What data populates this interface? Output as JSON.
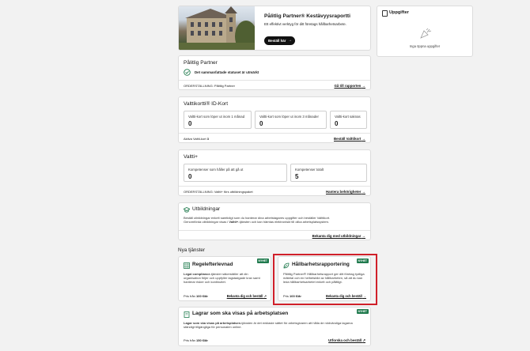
{
  "report_card": {
    "title": "Pålitlig Partner® Kestävyysraportti",
    "desc": "Ett effektivt verktyg för ditt företags hållbarhetsarbete.",
    "button": "Beställ här"
  },
  "tasks_card": {
    "title": "Uppgifter",
    "empty": "Inga öppna uppgifter"
  },
  "partner_card": {
    "title": "Pålitlig Partner",
    "status": "Det sammanfattade statuset är utmärkt",
    "subscription": "ORDERSTÄLLNING: Pålitlig Partner",
    "link": "Gå till rapporten"
  },
  "idcard_card": {
    "title": "Valttikortti® ID-Kort",
    "boxes": [
      {
        "label": "Valtti-kort som löper ut inom 1 månad",
        "value": "0"
      },
      {
        "label": "Valtti-kort som löper ut inom 3 månader",
        "value": "0"
      },
      {
        "label": "Valtti-kort saknas",
        "value": "0"
      }
    ],
    "active_label": "Aktiva Valtti-kort",
    "active_value": "3",
    "link": "Beställ Valttikort"
  },
  "valttiplus_card": {
    "title": "Valtti+",
    "boxes": [
      {
        "label": "Kompetenser som håller på att gå ut",
        "value": "0"
      },
      {
        "label": "Kompetenser totalt",
        "value": "5"
      }
    ],
    "subscription": "ORDERSTÄLLNING: Valtti+ förs utbildningspaket",
    "link": "Hantera behörigheter"
  },
  "training_card": {
    "title": "Utbildningar",
    "desc_1": "Beställ utbildningar enkelt samtidigt som du hanterar dina arbetstagares uppgifter och beställer Valttikort.",
    "desc_2a": "Genomförda utbildningar visas i ",
    "desc_2b": "Valtti+",
    "desc_2c": "-tjänsten och kan hämtas elektroniskt till olika arbetsplatssystem.",
    "link": "Bekanta dig med utbildningar"
  },
  "new_services": {
    "heading": "Nya tjänster",
    "services": [
      {
        "title": "Regelefterlevnad",
        "badge": "NYHET",
        "bold": "Legal compliance",
        "desc": "-tjänster säkerställer att din organisation följer och uppfyller lagstadgade krav samt hanterar risker och kontinuitet.",
        "price_label": "Pris från",
        "price": "100 €/år",
        "link": "Bekanta dig och beställ"
      },
      {
        "title": "Hållbarhetsrapportering",
        "badge": "NYHET",
        "bold": "",
        "desc": "Pålitlig Partner® Hållbarhetsrapport ger ditt företag tydliga mätetal och en helhetsbild av hållbarheten, så att du kan leda hållbarhetsarbetet enkelt och pålitligt.",
        "price_label": "Pris",
        "price": "100 €/år",
        "link": "Bekanta dig och beställ"
      },
      {
        "title": "Lagrar som ska visas på arbetsplatsen",
        "badge": "NYHET",
        "bold": "Lagar som ska visas på arbetsplatsen",
        "desc": "-tjänsten är det enklaste sättet för arbetsgivaren att hålla de nödvändiga lagarna ständigt tillgängliga för personalen online.",
        "price_label": "Pris från",
        "price": "150 €/år",
        "link": "Utforska och beställ"
      }
    ]
  },
  "colors": {
    "accent_green": "#1f7a4d",
    "highlight_red": "#d0202a"
  }
}
